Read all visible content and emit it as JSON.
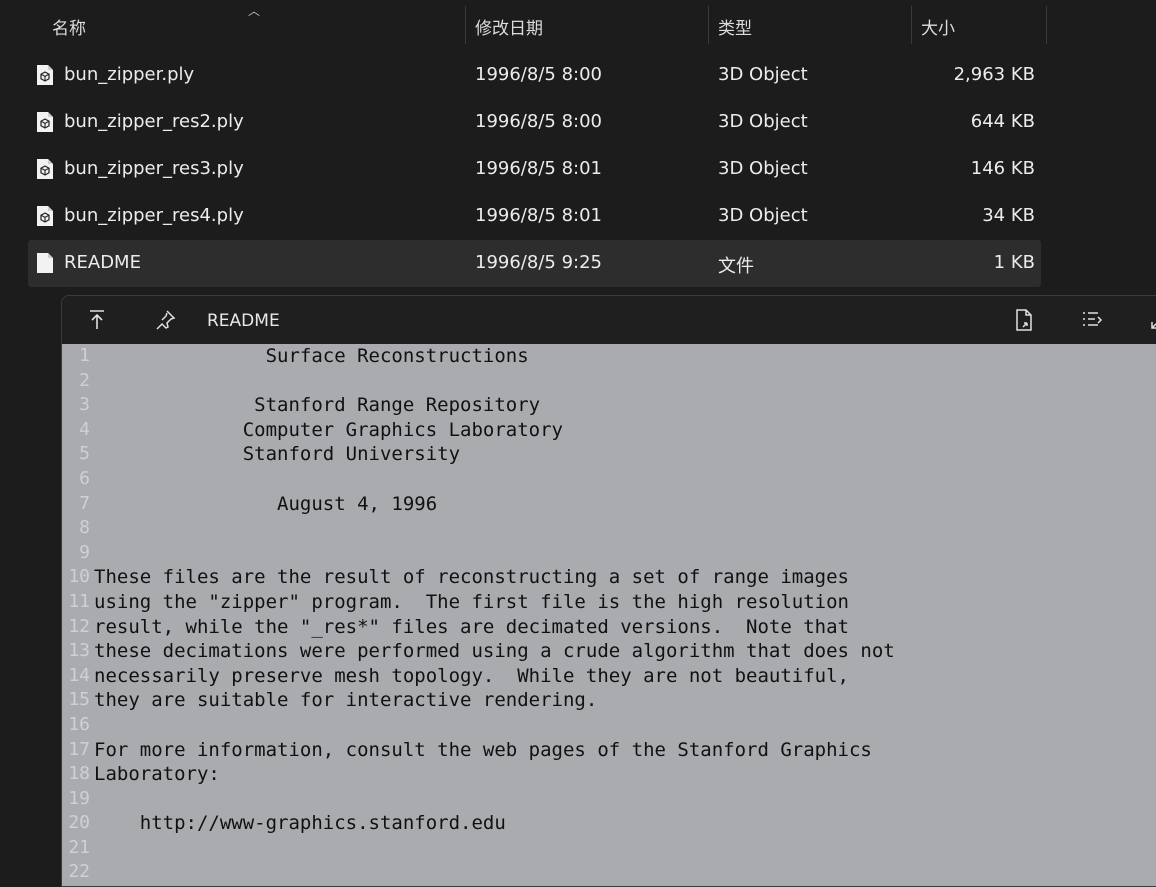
{
  "columns": {
    "name": "名称",
    "date": "修改日期",
    "type": "类型",
    "size": "大小"
  },
  "files": [
    {
      "name": "bun_zipper.ply",
      "date": "1996/8/5 8:00",
      "type": "3D Object",
      "size": "2,963 KB",
      "icon": "3d-object-icon"
    },
    {
      "name": "bun_zipper_res2.ply",
      "date": "1996/8/5 8:00",
      "type": "3D Object",
      "size": "644 KB",
      "icon": "3d-object-icon"
    },
    {
      "name": "bun_zipper_res3.ply",
      "date": "1996/8/5 8:01",
      "type": "3D Object",
      "size": "146 KB",
      "icon": "3d-object-icon"
    },
    {
      "name": "bun_zipper_res4.ply",
      "date": "1996/8/5 8:01",
      "type": "3D Object",
      "size": "34 KB",
      "icon": "3d-object-icon"
    },
    {
      "name": "README",
      "date": "1996/8/5 9:25",
      "type": "文件",
      "size": "1 KB",
      "icon": "file-icon"
    }
  ],
  "preview": {
    "title": "README",
    "lines": [
      "               Surface Reconstructions",
      "",
      "              Stanford Range Repository",
      "             Computer Graphics Laboratory",
      "             Stanford University",
      "",
      "                August 4, 1996",
      "",
      "",
      "These files are the result of reconstructing a set of range images",
      "using the \"zipper\" program.  The first file is the high resolution",
      "result, while the \"_res*\" files are decimated versions.  Note that",
      "these decimations were performed using a crude algorithm that does not",
      "necessarily preserve mesh topology.  While they are not beautiful,",
      "they are suitable for interactive rendering.",
      "",
      "For more information, consult the web pages of the Stanford Graphics",
      "Laboratory:",
      "",
      "    http://www-graphics.stanford.edu",
      "",
      ""
    ]
  }
}
